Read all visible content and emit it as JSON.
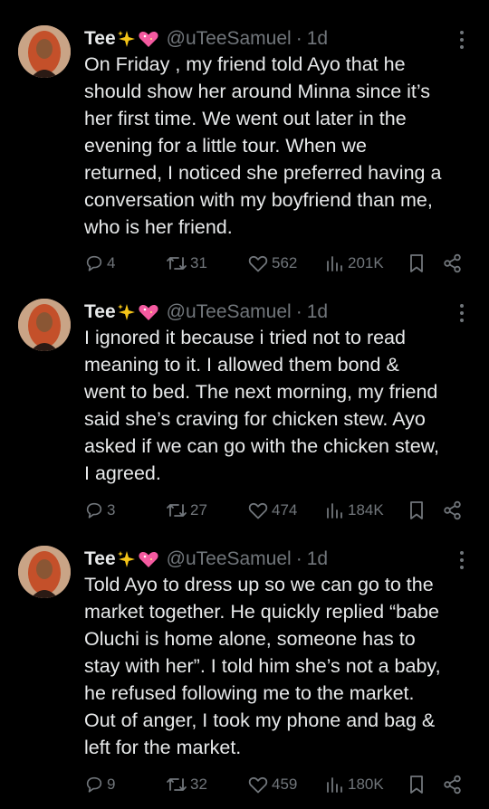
{
  "tweets": [
    {
      "display_name": "Tee",
      "handle": "@uTeeSamuel",
      "separator": "·",
      "time": "1d",
      "text": "On Friday , my friend told Ayo that he\nshould show her around Minna since it’s\nher first time. We went out later in the\nevening for a little tour. When we\nreturned, I noticed she preferred having a\nconversation with my boyfriend than me,\nwho is her friend.",
      "replies": "4",
      "retweets": "31",
      "likes": "562",
      "views": "201K"
    },
    {
      "display_name": "Tee",
      "handle": "@uTeeSamuel",
      "separator": "·",
      "time": "1d",
      "text": "I ignored it because i tried not to read\nmeaning to it. I allowed them bond &\nwent to bed. The next morning, my friend\nsaid she’s craving for chicken stew. Ayo\nasked if we can go with the chicken stew,\nI agreed.",
      "replies": "3",
      "retweets": "27",
      "likes": "474",
      "views": "184K"
    },
    {
      "display_name": "Tee",
      "handle": "@uTeeSamuel",
      "separator": "·",
      "time": "1d",
      "text": "Told Ayo to dress up so we can go to the\nmarket together. He quickly replied “babe\nOluchi is home alone, someone has to\nstay with her”. I told him she’s not a baby,\nhe refused following me to the market.\nOut of anger, I took my phone and bag &\nleft for the market.",
      "replies": "9",
      "retweets": "32",
      "likes": "459",
      "views": "180K"
    }
  ],
  "icons": {
    "name_emojis": [
      "sparkles-icon",
      "sparkling-heart-icon"
    ],
    "actions": [
      "reply-icon",
      "retweet-icon",
      "like-icon",
      "views-icon",
      "bookmark-icon",
      "share-icon"
    ],
    "more": "more-vertical-icon"
  },
  "colors": {
    "background": "#000000",
    "text": "#e7e9ea",
    "secondary": "#71767b",
    "sparkles": "#f5c518",
    "heart": "#f45aa0"
  }
}
